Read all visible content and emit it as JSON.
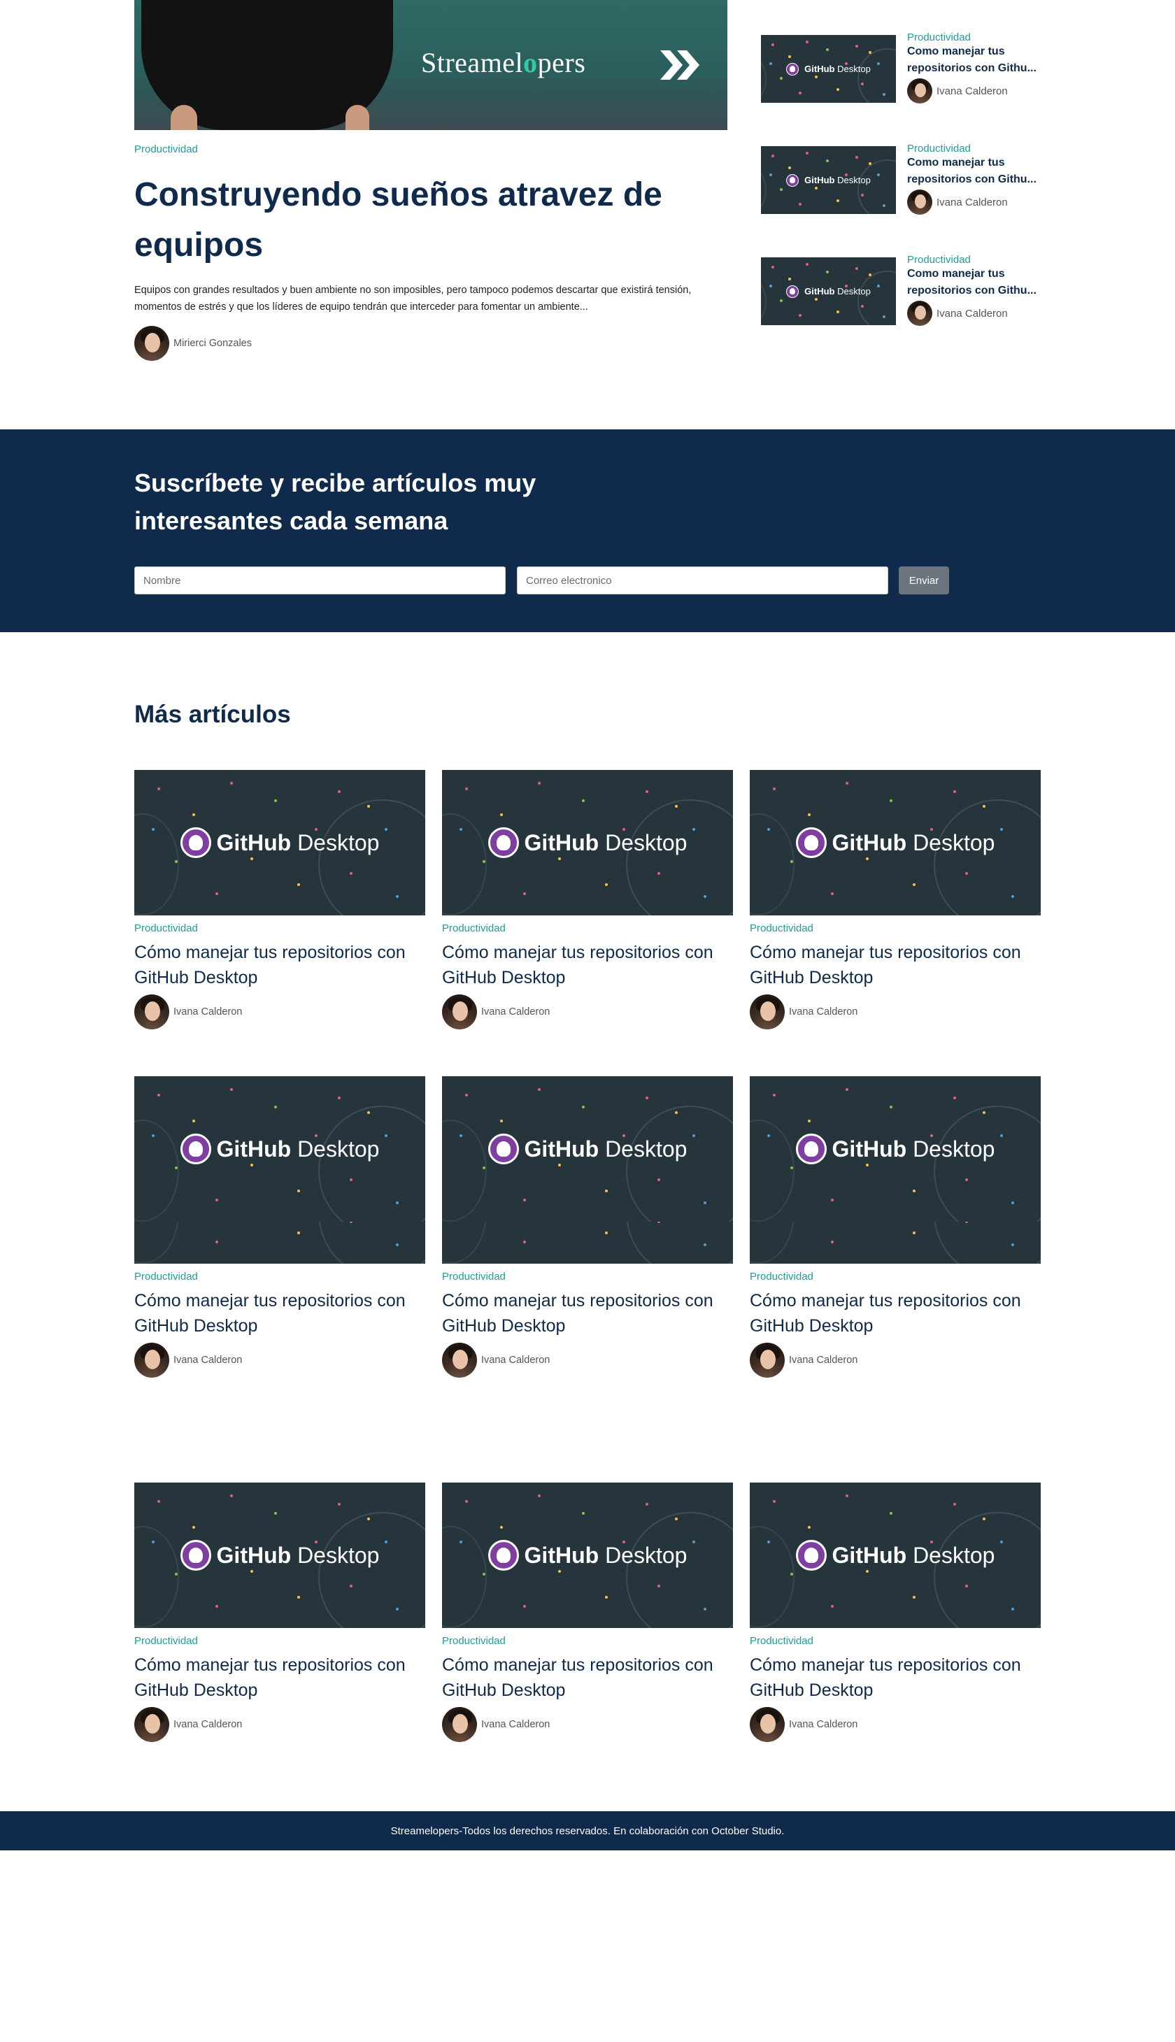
{
  "featured": {
    "brand_name": "Streamelopers",
    "brand_text_a": "Streamel",
    "brand_text_x": "o",
    "brand_text_b": "pers",
    "category": "Productividad",
    "title": "Construyendo sueños atravez de equipos",
    "excerpt": "Equipos con grandes resultados y buen ambiente no son imposibles, pero tampoco podemos descartar que existirá tensión, momentos de estrés y que los líderes de equipo tendrán que interceder para fomentar un ambiente...",
    "author": "Mirierci Gonzales"
  },
  "sidebar": {
    "items": [
      {
        "category": "Productividad",
        "title": "Como manejar tus repositorios con Githu...",
        "title_l1": "Como manejar tus",
        "title_l2": "repositorios con Githu...",
        "author": "Ivana Calderon"
      },
      {
        "category": "Productividad",
        "title": "Como manejar tus repositorios con Githu...",
        "title_l1": "Como manejar tus",
        "title_l2": "repositorios con Githu...",
        "author": "Ivana Calderon"
      },
      {
        "category": "Productividad",
        "title": "Como manejar tus repositorios con Githu...",
        "title_l1": "Como manejar tus",
        "title_l2": "repositorios con Githu...",
        "author": "Ivana Calderon"
      }
    ]
  },
  "thumb": {
    "gh": "GitHub",
    "dk": "Desktop"
  },
  "newsletter": {
    "title": "Suscríbete y recibe artículos muy interesantes cada semana",
    "name_placeholder": "Nombre",
    "email_placeholder": "Correo electronico",
    "submit_label": "Enviar"
  },
  "more": {
    "title": "Más artículos",
    "cards": [
      {
        "category": "Productividad",
        "title": "Cómo manejar tus repositorios con GitHub Desktop",
        "author": "Ivana Calderon"
      },
      {
        "category": "Productividad",
        "title": "Cómo manejar tus repositorios con GitHub Desktop",
        "author": "Ivana Calderon"
      },
      {
        "category": "Productividad",
        "title": "Cómo manejar tus repositorios con GitHub Desktop",
        "author": "Ivana Calderon"
      },
      {
        "category": "Productividad",
        "title": "Cómo manejar tus repositorios con GitHub Desktop",
        "author": "Ivana Calderon"
      },
      {
        "category": "Productividad",
        "title": "Cómo manejar tus repositorios con GitHub Desktop",
        "author": "Ivana Calderon"
      },
      {
        "category": "Productividad",
        "title": "Cómo manejar tus repositorios con GitHub Desktop",
        "author": "Ivana Calderon"
      },
      {
        "category": "Productividad",
        "title": "Cómo manejar tus repositorios con GitHub Desktop",
        "author": "Ivana Calderon"
      },
      {
        "category": "Productividad",
        "title": "Cómo manejar tus repositorios con GitHub Desktop",
        "author": "Ivana Calderon"
      },
      {
        "category": "Productividad",
        "title": "Cómo manejar tus repositorios con GitHub Desktop",
        "author": "Ivana Calderon"
      }
    ]
  },
  "footer": {
    "text": "Streamelopers-Todos los derechos reservados. En colaboración con October Studio."
  },
  "colors": {
    "primary_navy": "#0f2a4a",
    "accent_teal": "#1f9d9a",
    "thumb_bg": "#26353b",
    "github_purple": "#7e3fa1",
    "button_gray": "#6c757d"
  }
}
